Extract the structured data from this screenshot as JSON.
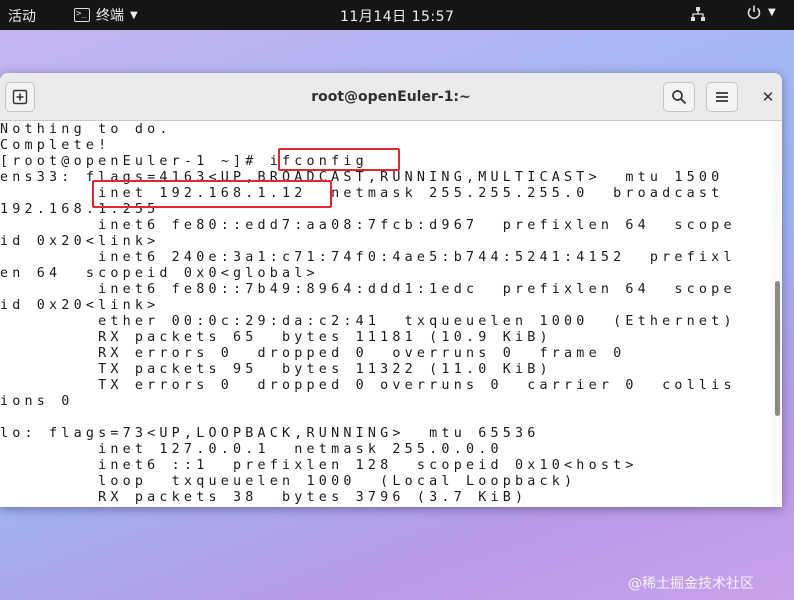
{
  "topbar": {
    "activities": "活动",
    "app_name": "终端",
    "clock": "11月14日  15:57"
  },
  "window": {
    "title": "root@openEuler-1:~"
  },
  "terminal": {
    "lines": [
      "Nothing to do.",
      "Complete!",
      "[root@openEuler-1 ~]# ifconfig",
      "ens33: flags=4163<UP,BROADCAST,RUNNING,MULTICAST>  mtu 1500",
      "        inet 192.168.1.12  netmask 255.255.255.0  broadcast",
      "192.168.1.255",
      "        inet6 fe80::edd7:aa08:7fcb:d967  prefixlen 64  scope",
      "id 0x20<link>",
      "        inet6 240e:3a1:c71:74f0:4ae5:b744:5241:4152  prefixl",
      "en 64  scopeid 0x0<global>",
      "        inet6 fe80::7b49:8964:ddd1:1edc  prefixlen 64  scope",
      "id 0x20<link>",
      "        ether 00:0c:29:da:c2:41  txqueuelen 1000  (Ethernet)",
      "        RX packets 65  bytes 11181 (10.9 KiB)",
      "        RX errors 0  dropped 0  overruns 0  frame 0",
      "        TX packets 95  bytes 11322 (11.0 KiB)",
      "        TX errors 0  dropped 0 overruns 0  carrier 0  collis",
      "ions 0",
      "",
      "lo: flags=73<UP,LOOPBACK,RUNNING>  mtu 65536",
      "        inet 127.0.0.1  netmask 255.0.0.0",
      "        inet6 ::1  prefixlen 128  scopeid 0x10<host>",
      "        loop  txqueuelen 1000  (Local Loopback)",
      "        RX packets 38  bytes 3796 (3.7 KiB)"
    ]
  },
  "watermark": "@稀土掘金技术社区",
  "colors": {
    "highlight": "#e3262b",
    "topbar_bg": "#151515",
    "headerbar_bg": "#ebebeb"
  }
}
